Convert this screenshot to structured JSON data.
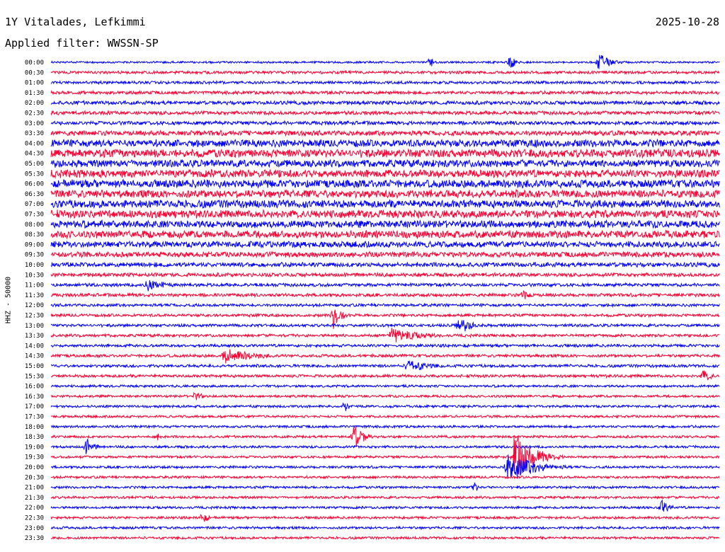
{
  "header": {
    "station": "1Y Vitalades, Lefkimmi",
    "date": "2025-10-28",
    "filter": "Applied filter: WWSSN-SP",
    "channel": "HHZ - 50000"
  },
  "chart_data": {
    "type": "line",
    "title": "1Y Vitalades, Lefkimmi",
    "ylabel": "HHZ - 50000",
    "row_labels": [
      "00:00",
      "00:30",
      "01:00",
      "01:30",
      "02:00",
      "02:30",
      "03:00",
      "03:30",
      "04:00",
      "04:30",
      "05:00",
      "05:30",
      "06:00",
      "06:30",
      "07:00",
      "07:30",
      "08:00",
      "08:30",
      "09:00",
      "09:30",
      "10:00",
      "10:30",
      "11:00",
      "11:30",
      "12:00",
      "12:30",
      "13:00",
      "13:30",
      "14:00",
      "14:30",
      "15:00",
      "15:30",
      "16:00",
      "16:30",
      "17:00",
      "17:30",
      "18:00",
      "18:30",
      "19:00",
      "19:30",
      "20:00",
      "20:30",
      "21:00",
      "21:30",
      "22:00",
      "22:30",
      "23:00",
      "23:30"
    ],
    "row_minutes": 30,
    "trace_colors": [
      "#0000ff",
      "#ff0033"
    ],
    "row_noise_level": [
      0.25,
      0.35,
      0.35,
      0.4,
      0.45,
      0.45,
      0.45,
      0.6,
      0.9,
      1.0,
      0.9,
      0.95,
      0.95,
      0.95,
      0.95,
      0.95,
      0.9,
      0.9,
      0.75,
      0.65,
      0.55,
      0.45,
      0.4,
      0.4,
      0.35,
      0.35,
      0.35,
      0.35,
      0.35,
      0.35,
      0.35,
      0.35,
      0.3,
      0.3,
      0.3,
      0.3,
      0.3,
      0.3,
      0.3,
      0.3,
      0.3,
      0.3,
      0.3,
      0.3,
      0.3,
      0.3,
      0.3,
      0.3
    ],
    "events": [
      {
        "row": 0,
        "minute": 17.0,
        "amplitude": 1.5,
        "duration": 0.6
      },
      {
        "row": 0,
        "minute": 20.6,
        "amplitude": 1.8,
        "duration": 0.8
      },
      {
        "row": 0,
        "minute": 24.6,
        "amplitude": 2.4,
        "duration": 1.5
      },
      {
        "row": 22,
        "minute": 4.3,
        "amplitude": 2.0,
        "duration": 2.5
      },
      {
        "row": 23,
        "minute": 21.2,
        "amplitude": 1.5,
        "duration": 1.2
      },
      {
        "row": 25,
        "minute": 12.7,
        "amplitude": 3.5,
        "duration": 1.0
      },
      {
        "row": 26,
        "minute": 18.3,
        "amplitude": 2.0,
        "duration": 2.0
      },
      {
        "row": 27,
        "minute": 15.3,
        "amplitude": 2.0,
        "duration": 4.0
      },
      {
        "row": 29,
        "minute": 7.8,
        "amplitude": 2.0,
        "duration": 4.0
      },
      {
        "row": 30,
        "minute": 16.0,
        "amplitude": 1.8,
        "duration": 3.0
      },
      {
        "row": 31,
        "minute": 29.3,
        "amplitude": 1.8,
        "duration": 1.0
      },
      {
        "row": 33,
        "minute": 6.5,
        "amplitude": 2.0,
        "duration": 0.6
      },
      {
        "row": 34,
        "minute": 13.2,
        "amplitude": 1.5,
        "duration": 0.5
      },
      {
        "row": 37,
        "minute": 13.6,
        "amplitude": 3.5,
        "duration": 1.2
      },
      {
        "row": 37,
        "minute": 4.7,
        "amplitude": 1.4,
        "duration": 0.5
      },
      {
        "row": 38,
        "minute": 1.6,
        "amplitude": 2.2,
        "duration": 1.0
      },
      {
        "row": 39,
        "minute": 20.8,
        "amplitude": 6.0,
        "duration": 2.5
      },
      {
        "row": 40,
        "minute": 20.5,
        "amplitude": 4.0,
        "duration": 3.5
      },
      {
        "row": 42,
        "minute": 19.0,
        "amplitude": 2.0,
        "duration": 0.4
      },
      {
        "row": 44,
        "minute": 27.4,
        "amplitude": 2.2,
        "duration": 1.0
      },
      {
        "row": 45,
        "minute": 6.8,
        "amplitude": 1.5,
        "duration": 0.8
      }
    ]
  }
}
